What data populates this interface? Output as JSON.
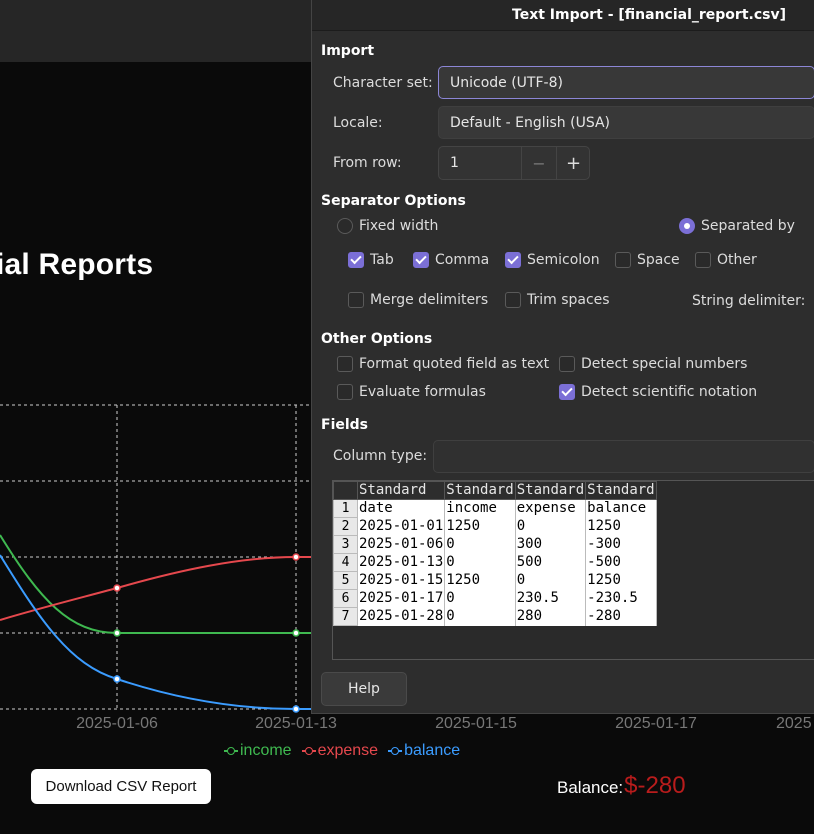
{
  "page": {
    "heading": "ial Reports",
    "x_ticks": [
      "2025-01-06",
      "2025-01-13",
      "2025-01-15",
      "2025-01-17",
      "2025"
    ],
    "legend": [
      {
        "label": "income",
        "color": "#3fb950"
      },
      {
        "label": "expense",
        "color": "#e5484d"
      },
      {
        "label": "balance",
        "color": "#3b9cff"
      }
    ],
    "download_label": "Download CSV Report",
    "balance_label": "Balance:",
    "balance_value": "$-280",
    "balance_color": "#b91c1c"
  },
  "chart_data": {
    "type": "line",
    "categories": [
      "2025-01-01",
      "2025-01-06",
      "2025-01-13",
      "2025-01-15",
      "2025-01-17",
      "2025-01-28"
    ],
    "series": [
      {
        "name": "income",
        "values": [
          1250,
          0,
          0,
          1250,
          0,
          0
        ]
      },
      {
        "name": "expense",
        "values": [
          0,
          300,
          500,
          0,
          230.5,
          280
        ]
      },
      {
        "name": "balance",
        "values": [
          1250,
          -300,
          -500,
          1250,
          -230.5,
          -280
        ]
      }
    ],
    "grid": true,
    "legend_position": "bottom"
  },
  "dialog": {
    "title": "Text Import - [financial_report.csv]",
    "import_section": "Import",
    "charset_label": "Character set:",
    "charset_value": "Unicode (UTF-8)",
    "locale_label": "Locale:",
    "locale_value": "Default - English (USA)",
    "fromrow_label": "From row:",
    "fromrow_value": "1",
    "minus_glyph": "−",
    "plus_glyph": "+",
    "separator_section": "Separator Options",
    "fixed_width": "Fixed width",
    "separated_by": "Separated by",
    "tab": "Tab",
    "comma": "Comma",
    "semicolon": "Semicolon",
    "space": "Space",
    "other": "Other",
    "merge_delimiters": "Merge delimiters",
    "trim_spaces": "Trim spaces",
    "string_delimiter": "String delimiter:",
    "other_section": "Other Options",
    "format_quoted": "Format quoted field as text",
    "detect_special": "Detect special numbers",
    "evaluate_formulas": "Evaluate formulas",
    "detect_scientific": "Detect scientific notation",
    "fields_section": "Fields",
    "column_type_label": "Column type:",
    "help_label": "Help",
    "preview": {
      "headers": [
        "Standard",
        "Standard",
        "Standard",
        "Standard"
      ],
      "rows": [
        {
          "n": "1",
          "c": [
            "date",
            "income",
            "expense",
            "balance"
          ]
        },
        {
          "n": "2",
          "c": [
            "2025-01-01",
            "1250",
            "0",
            "1250"
          ]
        },
        {
          "n": "3",
          "c": [
            "2025-01-06",
            "0",
            "300",
            "-300"
          ]
        },
        {
          "n": "4",
          "c": [
            "2025-01-13",
            "0",
            "500",
            "-500"
          ]
        },
        {
          "n": "5",
          "c": [
            "2025-01-15",
            "1250",
            "0",
            "1250"
          ]
        },
        {
          "n": "6",
          "c": [
            "2025-01-17",
            "0",
            "230.5",
            "-230.5"
          ]
        },
        {
          "n": "7",
          "c": [
            "2025-01-28",
            "0",
            "280",
            "-280"
          ]
        }
      ]
    }
  }
}
